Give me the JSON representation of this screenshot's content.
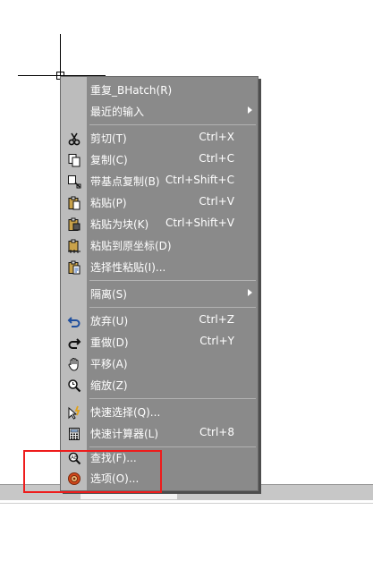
{
  "context_menu": {
    "items": [
      {
        "label": "重复_BHatch(R)",
        "shortcut": "",
        "icon": "",
        "submenu": false
      },
      {
        "label": "最近的输入",
        "shortcut": "",
        "icon": "",
        "submenu": true
      },
      {
        "label": "剪切(T)",
        "shortcut": "Ctrl+X",
        "icon": "scissors-icon",
        "submenu": false
      },
      {
        "label": "复制(C)",
        "shortcut": "Ctrl+C",
        "icon": "copy-icon",
        "submenu": false
      },
      {
        "label": "带基点复制(B)",
        "shortcut": "Ctrl+Shift+C",
        "icon": "copy-with-basepoint-icon",
        "submenu": false
      },
      {
        "label": "粘贴(P)",
        "shortcut": "Ctrl+V",
        "icon": "paste-icon",
        "submenu": false
      },
      {
        "label": "粘贴为块(K)",
        "shortcut": "Ctrl+Shift+V",
        "icon": "paste-as-block-icon",
        "submenu": false
      },
      {
        "label": "粘贴到原坐标(D)",
        "shortcut": "",
        "icon": "paste-to-original-coords-icon",
        "submenu": false
      },
      {
        "label": "选择性粘贴(I)...",
        "shortcut": "",
        "icon": "paste-special-icon",
        "submenu": false
      },
      {
        "label": "隔离(S)",
        "shortcut": "",
        "icon": "",
        "submenu": true
      },
      {
        "label": "放弃(U)",
        "shortcut": "Ctrl+Z",
        "icon": "undo-icon",
        "submenu": false
      },
      {
        "label": "重做(D)",
        "shortcut": "Ctrl+Y",
        "icon": "redo-icon",
        "submenu": false
      },
      {
        "label": "平移(A)",
        "shortcut": "",
        "icon": "pan-hand-icon",
        "submenu": false
      },
      {
        "label": "缩放(Z)",
        "shortcut": "",
        "icon": "zoom-icon",
        "submenu": false
      },
      {
        "label": "快速选择(Q)...",
        "shortcut": "",
        "icon": "quick-select-icon",
        "submenu": false
      },
      {
        "label": "快速计算器(L)",
        "shortcut": "Ctrl+8",
        "icon": "calculator-icon",
        "submenu": false
      },
      {
        "label": "查找(F)...",
        "shortcut": "",
        "icon": "find-icon",
        "submenu": false
      },
      {
        "label": "选项(O)...",
        "shortcut": "",
        "icon": "options-icon",
        "submenu": false
      }
    ]
  },
  "colors": {
    "menu_bg": "#8a8a8a",
    "gutter_bg": "#bcbcbc",
    "text": "#ffffff",
    "highlight": "#ee1c1c"
  }
}
